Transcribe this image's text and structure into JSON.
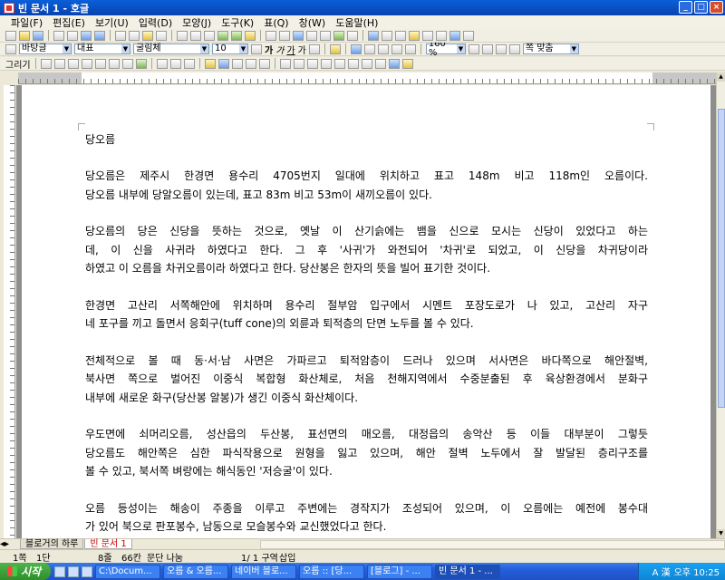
{
  "window": {
    "title": "빈 문서 1 - 호글",
    "buttons": [
      "_",
      "□",
      "×"
    ]
  },
  "menu": [
    "파일(F)",
    "편집(E)",
    "보기(U)",
    "입력(D)",
    "모양(J)",
    "도구(K)",
    "표(Q)",
    "창(W)",
    "도움말(H)"
  ],
  "format_toolbar": {
    "style": "바탕글",
    "language": "대표",
    "font": "굴림체",
    "size": "10",
    "format_glyphs": [
      "가",
      "가",
      "가",
      "가"
    ],
    "zoom": "160 %",
    "fit": "쪽 맞춤"
  },
  "draw_toolbar": {
    "label": "그리기"
  },
  "document": {
    "title": "당오름",
    "paragraphs": [
      [
        "당오름은 제주시 한경면 용수리 4705번지 일대에 위치하고 표고 148m 비고 118m인 오름이다.",
        "당오름 내부에 당알오름이 있는데, 표고 83m 비고 53m이 새끼오름이 있다."
      ],
      [
        "당오름의 당은 신당을 뜻하는 것으로, 옛날 이 산기슭에는 뱀을 신으로 모시는 신당이 있었다고 하는",
        "데, 이 신을 사귀라 하였다고 한다. 그 후 '사귀'가 와전되어 '차귀'로 되었고, 이 신당을 차귀당이라",
        "하였고 이 오름을 차귀오름이라 하였다고 한다. 당산봉은 한자의 뜻을 빌어 표기한 것이다."
      ],
      [
        "한경면 고산리 서쪽해안에 위치하며 용수리 절부암 입구에서 시멘트 포장도로가 나 있고, 고산리 자구",
        "네 포구를 끼고 돌면서 응회구(tuff cone)의 외륜과 퇴적층의 단면 노두를 볼 수 있다."
      ],
      [
        "전체적으로 볼 때 동·서·남 사면은 가파르고 퇴적암층이 드러나 있으며 서사면은 바다쪽으로 해안절벽,",
        "북사면 쪽으로 벌어진 이중식 복합형 화산체로, 처음 천해지역에서 수중분출된 후 육상환경에서 분화구",
        "내부에 새로운 화구(당산봉 알봉)가 생긴 이중식 화산체이다."
      ],
      [
        "우도면에 쇠머리오름, 성산읍의 두산봉, 표선면의 매오름, 대정읍의 송악산 등 이들 대부분이 그렇듯",
        "당오름도 해안쪽은 심한 파식작용으로 원형을 잃고 있으며, 해안 절벽 노두에서 잘 발달된 층리구조를",
        "볼 수 있고, 북서쪽 벼랑에는 해식동인 '저승굴'이 있다."
      ],
      [
        "오름 등성이는 해송이 주종을 이루고 주변에는 경작지가 조성되어 있으며, 이 오름에는 예전에 봉수대",
        "가 있어 북으로 판포봉수, 남동으로 모슬봉수와 교신했었다고 한다."
      ]
    ]
  },
  "tabs": [
    "블로거의 하루",
    "빈 문서 1"
  ],
  "status": {
    "page": "1쪽",
    "section": "1단",
    "line": "8줄",
    "col": "66칸",
    "break": "문단 나눔",
    "pos": "1/ 1 구역",
    "mode": "삽입"
  },
  "taskbar": {
    "start": "시작",
    "buttons": [
      "C:\\Docum...",
      "오름 & 오름...",
      "네이버 블로...",
      "오름 :: [당...",
      "[블로그] - ...",
      "빈 문서 1 - ..."
    ],
    "ime": "A 漢",
    "clock": "오후 10:25"
  }
}
